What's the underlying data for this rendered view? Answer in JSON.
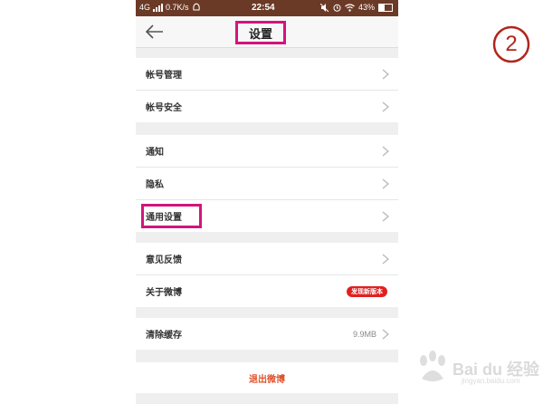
{
  "status_bar": {
    "network": "4G",
    "speed": "0.7K/s",
    "time": "22:54",
    "battery": "43%"
  },
  "header": {
    "back_icon": "arrow-left-icon",
    "title": "设置"
  },
  "groups": [
    {
      "items": [
        {
          "label": "帐号管理"
        },
        {
          "label": "帐号安全"
        }
      ]
    },
    {
      "items": [
        {
          "label": "通知"
        },
        {
          "label": "隐私"
        },
        {
          "label": "通用设置"
        }
      ]
    },
    {
      "items": [
        {
          "label": "意见反馈"
        },
        {
          "label": "关于微博",
          "badge": "发现新版本"
        }
      ]
    },
    {
      "items": [
        {
          "label": "清除缓存",
          "value": "9.9MB"
        }
      ]
    }
  ],
  "logout": {
    "label": "退出微博"
  },
  "step_marker": "2",
  "watermark": {
    "brand": "Bai du 经验",
    "sub": "jingyan.baidu.com"
  },
  "colors": {
    "status_bar": "#6b3a27",
    "highlight": "#d1157d",
    "badge": "#e02020",
    "logout": "#e0532c",
    "step": "#b1261c"
  }
}
